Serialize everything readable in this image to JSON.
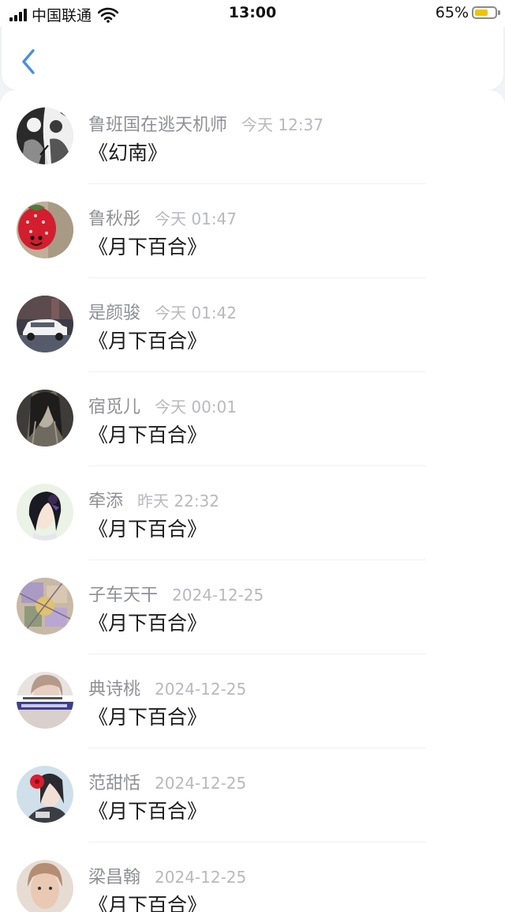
{
  "status_bar": {
    "carrier": "中国联通",
    "time": "13:00",
    "battery_percent": "65%",
    "battery_level": 0.65,
    "battery_color": "#f2c200"
  },
  "nav": {
    "back_icon": "chevron-left-icon",
    "accent_color": "#4a90d9"
  },
  "items": [
    {
      "name": "鲁班国在逃天机师",
      "time": "今天 12:37",
      "title": "《幻南》",
      "avatar": "avatar-ink-drawing"
    },
    {
      "name": "鲁秋彤",
      "time": "今天 01:47",
      "title": "《月下百合》",
      "avatar": "avatar-red-berry-face"
    },
    {
      "name": "是颜骏",
      "time": "今天 01:42",
      "title": "《月下百合》",
      "avatar": "avatar-white-car"
    },
    {
      "name": "宿觅儿",
      "time": "今天 00:01",
      "title": "《月下百合》",
      "avatar": "avatar-dark-hair-figure"
    },
    {
      "name": "牵添",
      "time": "昨天 22:32",
      "title": "《月下百合》",
      "avatar": "avatar-anime-portrait"
    },
    {
      "name": "子车天干",
      "time": "2024-12-25",
      "title": "《月下百合》",
      "avatar": "avatar-collage"
    },
    {
      "name": "典诗桃",
      "time": "2024-12-25",
      "title": "《月下百合》",
      "avatar": "avatar-face-with-caption"
    },
    {
      "name": "范甜恬",
      "time": "2024-12-25",
      "title": "《月下百合》",
      "avatar": "avatar-red-flower-girl"
    },
    {
      "name": "梁昌翰",
      "time": "2024-12-25",
      "title": "《月下百合》",
      "avatar": "avatar-face-closeup"
    }
  ]
}
